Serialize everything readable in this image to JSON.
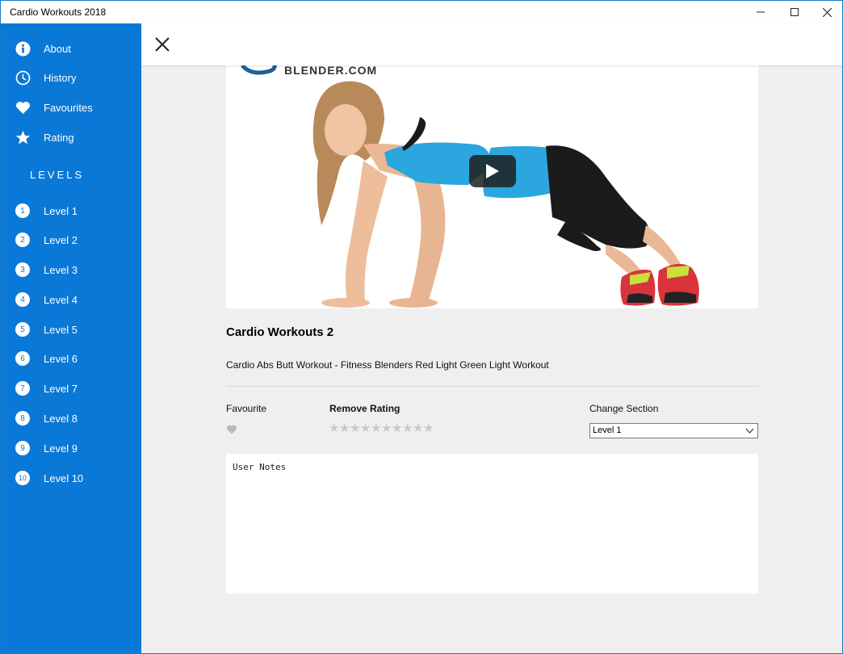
{
  "window": {
    "title": "Cardio Workouts 2018"
  },
  "colors": {
    "sidebar": "#0a78d7",
    "content_bg": "#efefef",
    "star_inactive": "#c9c9c9",
    "heart_inactive": "#b8b8b8"
  },
  "sidebar": {
    "items": [
      {
        "label": "About",
        "icon": "info-icon"
      },
      {
        "label": "History",
        "icon": "clock-icon"
      },
      {
        "label": "Favourites",
        "icon": "heart-icon"
      },
      {
        "label": "Rating",
        "icon": "star-icon"
      }
    ],
    "levels_heading": "LEVELS",
    "levels": [
      {
        "num": "1",
        "label": "Level 1"
      },
      {
        "num": "2",
        "label": "Level 2"
      },
      {
        "num": "3",
        "label": "Level 3"
      },
      {
        "num": "4",
        "label": "Level 4"
      },
      {
        "num": "5",
        "label": "Level 5"
      },
      {
        "num": "6",
        "label": "Level 6"
      },
      {
        "num": "7",
        "label": "Level 7"
      },
      {
        "num": "8",
        "label": "Level 8"
      },
      {
        "num": "9",
        "label": "Level 9"
      },
      {
        "num": "10",
        "label": "Level 10"
      }
    ]
  },
  "video": {
    "brand_text": "BLENDER.COM"
  },
  "workout": {
    "title": "Cardio Workouts 2",
    "description": "Cardio Abs Butt Workout - Fitness Blenders Red Light Green Light Workout"
  },
  "controls": {
    "favourite_label": "Favourite",
    "rating_label": "Remove Rating",
    "rating_value": 0,
    "rating_max": 10,
    "section_label": "Change Section",
    "section_selected": "Level 1"
  },
  "notes": {
    "placeholder": "User Notes"
  }
}
